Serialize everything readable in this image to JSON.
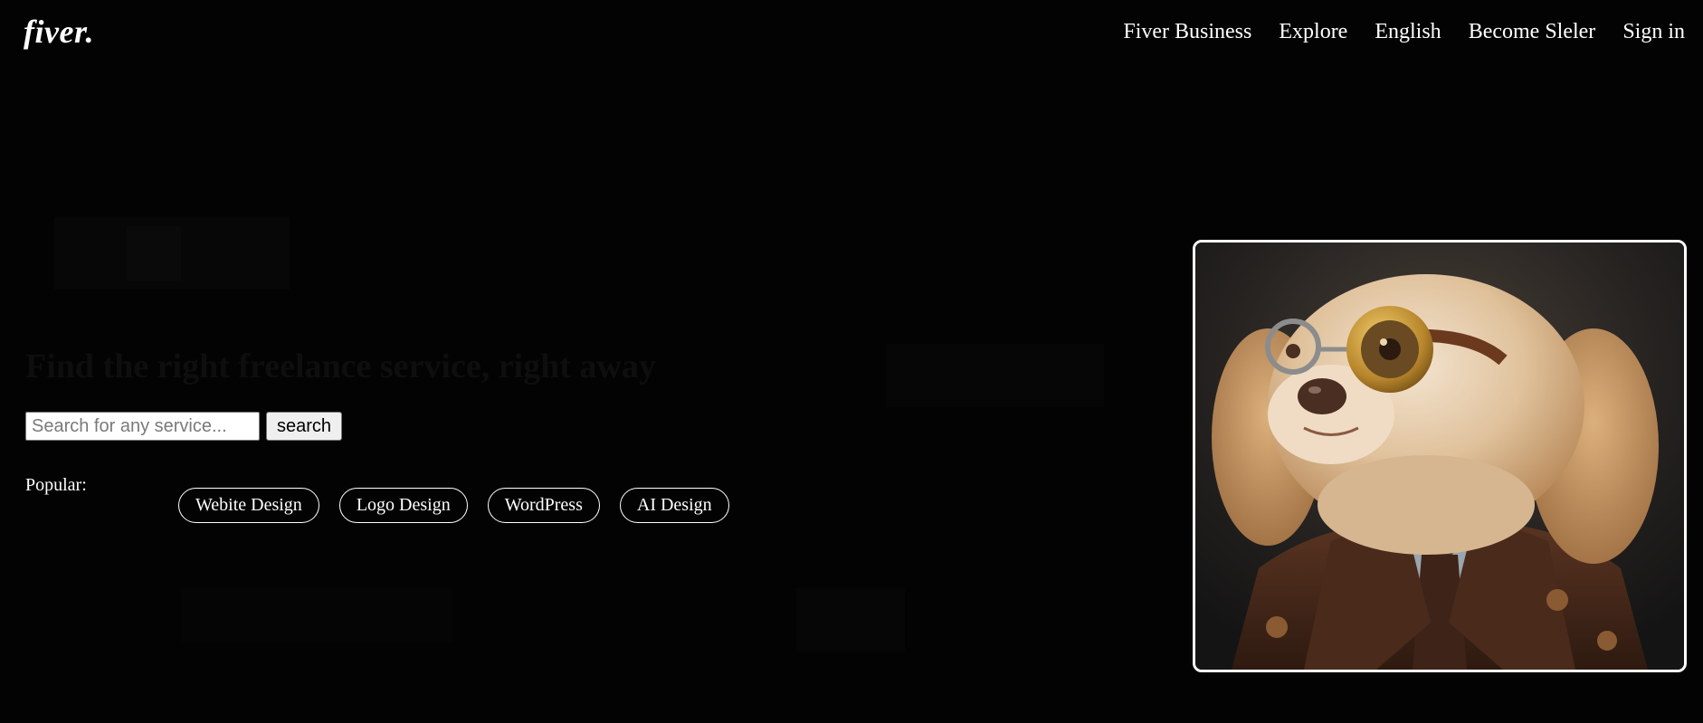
{
  "header": {
    "logo": "fiver.",
    "nav": [
      {
        "label": "Fiver Business"
      },
      {
        "label": "Explore"
      },
      {
        "label": "English"
      },
      {
        "label": "Become Sleler"
      },
      {
        "label": "Sign in"
      }
    ]
  },
  "hero": {
    "title": "Find the right freelance service, right away",
    "search": {
      "placeholder": "Search for any service...",
      "value": "",
      "button_label": "search"
    },
    "popular": {
      "label": "Popular:",
      "tags": [
        {
          "label": "Webite Design"
        },
        {
          "label": "Logo Design"
        },
        {
          "label": "WordPress"
        },
        {
          "label": "AI Design"
        }
      ]
    }
  },
  "image": {
    "subject": "dog-portrait",
    "colors": {
      "background": "#030303",
      "fur": "#d9b48a",
      "coat": "#4a2a1a",
      "goggle": "#c99a3a"
    }
  }
}
